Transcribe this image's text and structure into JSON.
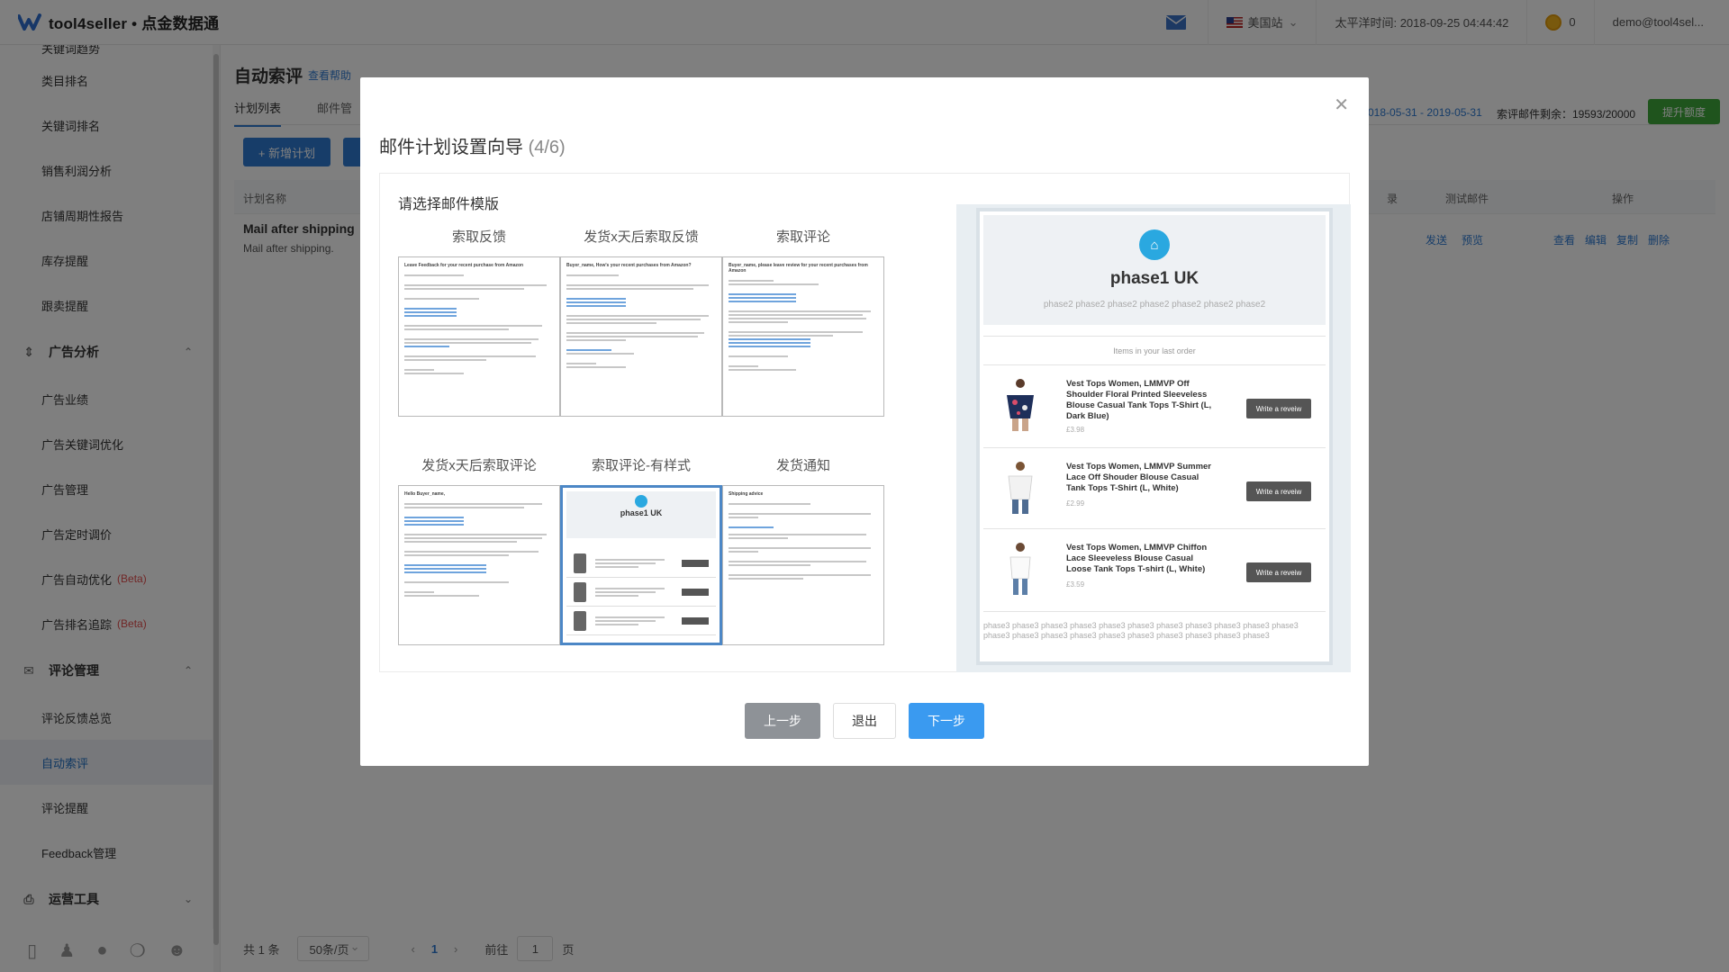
{
  "header": {
    "brand": "tool4seller • 点金数据通",
    "site": "美国站",
    "time": "太平洋时间: 2018-09-25 04:44:42",
    "coins": "0",
    "account": "demo@tool4sel..."
  },
  "sidebar": {
    "top_partial": "关键词趋势",
    "items_a": [
      "类目排名",
      "关键词排名",
      "销售利润分析",
      "店铺周期性报告",
      "库存提醒",
      "跟卖提醒"
    ],
    "group_ads": "广告分析",
    "items_ads": [
      "广告业绩",
      "广告关键词优化",
      "广告管理",
      "广告定时调价"
    ],
    "ads_auto": "广告自动优化",
    "ads_rank": "广告排名追踪",
    "beta": "(Beta)",
    "group_review": "评论管理",
    "items_review": [
      "评论反馈总览",
      "自动索评",
      "评论提醒",
      "Feedback管理"
    ],
    "group_ops": "运营工具"
  },
  "main": {
    "title": "自动索评",
    "help": "查看帮助",
    "tabs": [
      "计划列表",
      "邮件管"
    ],
    "new_plan": "+ 新增计划",
    "date_range": "018-05-31 - 2019-05-31",
    "quota": "索评邮件剩余：19593/20000",
    "upgrade": "提升额度",
    "columns": {
      "name": "计划名称",
      "status": "录",
      "test": "测试邮件",
      "ops": "操作"
    },
    "row": {
      "name": "Mail after shipping",
      "sub": "Mail after shipping."
    },
    "row_links_test": [
      "发送",
      "预览"
    ],
    "row_links_ops": [
      "查看",
      "编辑",
      "复制",
      "删除"
    ],
    "pager": {
      "total": "共 1 条",
      "size": "50条/页",
      "current": "1",
      "goto": "前往",
      "goto_val": "1",
      "page": "页"
    }
  },
  "modal": {
    "title": "邮件计划设置向导",
    "step": "(4/6)",
    "choose": "请选择邮件模版",
    "templates": [
      "索取反馈",
      "发货x天后索取反馈",
      "索取评论",
      "发货x天后索取评论",
      "索取评论-有样式",
      "发货通知"
    ],
    "card1_head": "Leave Feedback for your recent purchase from Amazon",
    "card2_head": "Buyer_name, How's your recent purchases from Amazon?",
    "card3_head": "Buyer_name, please leave review for your recent purchases from Amazon",
    "card4_head": "Hello Buyer_name,",
    "card5_shop": "phase1 UK",
    "card6_head": "Shipping advice",
    "prev": "上一步",
    "exit": "退出",
    "next": "下一步"
  },
  "preview": {
    "shop": "phase1 UK",
    "sub": "phase2 phase2 phase2 phase2 phase2 phase2 phase2",
    "last_order": "Items in your last order",
    "items": [
      {
        "title": "Vest Tops Women, LMMVP Off Shoulder Floral Printed Sleeveless Blouse Casual Tank Tops T-Shirt (L, Dark Blue)",
        "price": "£3.98",
        "btn": "Write a reveiw"
      },
      {
        "title": "Vest Tops Women, LMMVP Summer Lace Off Shouder Blouse Casual Tank Tops T-Shirt (L, White)",
        "price": "£2.99",
        "btn": "Write a reveiw"
      },
      {
        "title": "Vest Tops Women, LMMVP Chiffon Lace Sleeveless Blouse Casual Loose Tank Tops T-shirt (L, White)",
        "price": "£3.59",
        "btn": "Write a reveiw"
      }
    ],
    "footer": "phase3 phase3 phase3 phase3 phase3 phase3 phase3 phase3 phase3 phase3 phase3 phase3 phase3 phase3 phase3 phase3 phase3 phase3 phase3 phase3 phase3"
  },
  "colors": {
    "primary": "#2f7bd3",
    "next_btn": "#3a9af0",
    "upgrade": "#3fa83b",
    "beta": "#e24d4d"
  }
}
